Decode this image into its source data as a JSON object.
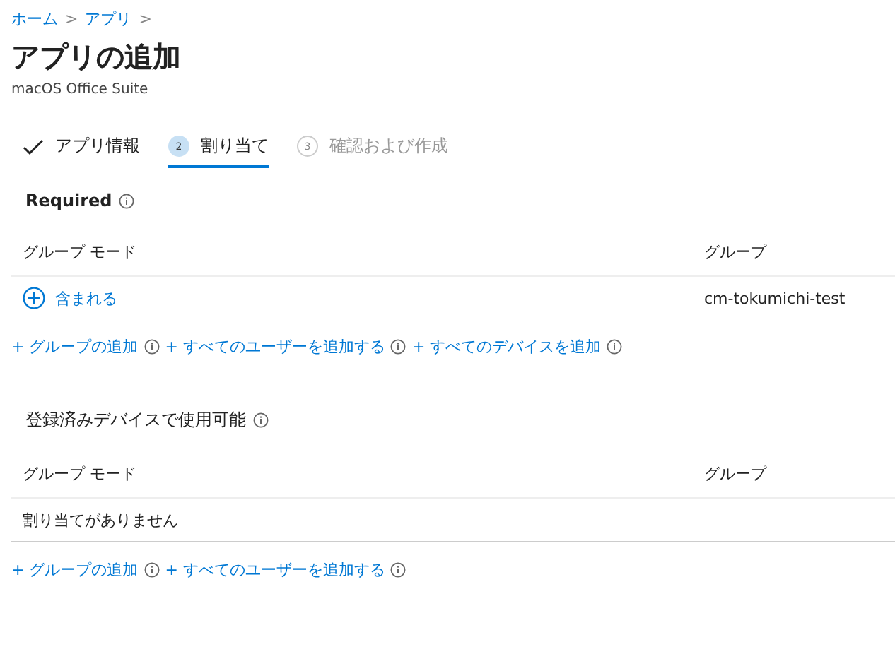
{
  "breadcrumb": [
    {
      "label": "ホーム",
      "separator": ">"
    },
    {
      "label": "アプリ",
      "separator": ">"
    }
  ],
  "title": "アプリの追加",
  "subtitle": "macOS Office Suite",
  "steps": [
    {
      "label": "アプリ情報",
      "kind": "done",
      "selected": false
    },
    {
      "number": "2",
      "label": "割り当て",
      "kind": "current",
      "selected": true
    },
    {
      "number": "3",
      "label": "確認および作成",
      "kind": "pending",
      "selected": false
    }
  ],
  "sections": [
    {
      "title": "Required",
      "bold": true,
      "columns": [
        "グループ モード",
        "グループ"
      ],
      "rows": [
        {
          "kind": "assignment",
          "mode": "含まれる",
          "group": "cm-tokumichi-test"
        }
      ],
      "links": [
        {
          "label": "+ グループの追加"
        },
        {
          "label": "+ すべてのユーザーを追加する"
        },
        {
          "label": "+ すべてのデバイスを追加"
        }
      ]
    },
    {
      "title": "登録済みデバイスで使用可能",
      "bold": false,
      "columns": [
        "グループ モード",
        "グループ"
      ],
      "rows": [
        {
          "kind": "empty",
          "message": "割り当てがありません"
        }
      ],
      "links": [
        {
          "label": "+ グループの追加"
        },
        {
          "label": "+ すべてのユーザーを追加する"
        }
      ]
    }
  ]
}
